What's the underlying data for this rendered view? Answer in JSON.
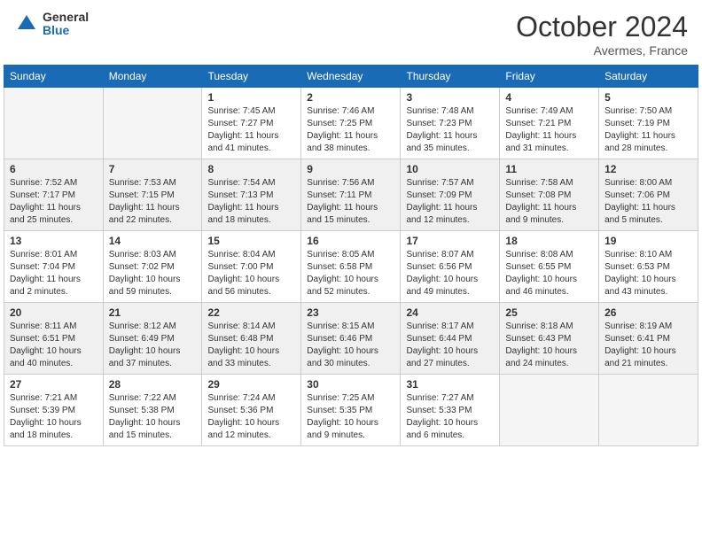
{
  "header": {
    "logo_general": "General",
    "logo_blue": "Blue",
    "month_title": "October 2024",
    "location": "Avermes, France"
  },
  "days_of_week": [
    "Sunday",
    "Monday",
    "Tuesday",
    "Wednesday",
    "Thursday",
    "Friday",
    "Saturday"
  ],
  "weeks": [
    [
      {
        "day": "",
        "empty": true
      },
      {
        "day": "",
        "empty": true
      },
      {
        "day": "1",
        "sunrise": "Sunrise: 7:45 AM",
        "sunset": "Sunset: 7:27 PM",
        "daylight": "Daylight: 11 hours and 41 minutes."
      },
      {
        "day": "2",
        "sunrise": "Sunrise: 7:46 AM",
        "sunset": "Sunset: 7:25 PM",
        "daylight": "Daylight: 11 hours and 38 minutes."
      },
      {
        "day": "3",
        "sunrise": "Sunrise: 7:48 AM",
        "sunset": "Sunset: 7:23 PM",
        "daylight": "Daylight: 11 hours and 35 minutes."
      },
      {
        "day": "4",
        "sunrise": "Sunrise: 7:49 AM",
        "sunset": "Sunset: 7:21 PM",
        "daylight": "Daylight: 11 hours and 31 minutes."
      },
      {
        "day": "5",
        "sunrise": "Sunrise: 7:50 AM",
        "sunset": "Sunset: 7:19 PM",
        "daylight": "Daylight: 11 hours and 28 minutes."
      }
    ],
    [
      {
        "day": "6",
        "sunrise": "Sunrise: 7:52 AM",
        "sunset": "Sunset: 7:17 PM",
        "daylight": "Daylight: 11 hours and 25 minutes."
      },
      {
        "day": "7",
        "sunrise": "Sunrise: 7:53 AM",
        "sunset": "Sunset: 7:15 PM",
        "daylight": "Daylight: 11 hours and 22 minutes."
      },
      {
        "day": "8",
        "sunrise": "Sunrise: 7:54 AM",
        "sunset": "Sunset: 7:13 PM",
        "daylight": "Daylight: 11 hours and 18 minutes."
      },
      {
        "day": "9",
        "sunrise": "Sunrise: 7:56 AM",
        "sunset": "Sunset: 7:11 PM",
        "daylight": "Daylight: 11 hours and 15 minutes."
      },
      {
        "day": "10",
        "sunrise": "Sunrise: 7:57 AM",
        "sunset": "Sunset: 7:09 PM",
        "daylight": "Daylight: 11 hours and 12 minutes."
      },
      {
        "day": "11",
        "sunrise": "Sunrise: 7:58 AM",
        "sunset": "Sunset: 7:08 PM",
        "daylight": "Daylight: 11 hours and 9 minutes."
      },
      {
        "day": "12",
        "sunrise": "Sunrise: 8:00 AM",
        "sunset": "Sunset: 7:06 PM",
        "daylight": "Daylight: 11 hours and 5 minutes."
      }
    ],
    [
      {
        "day": "13",
        "sunrise": "Sunrise: 8:01 AM",
        "sunset": "Sunset: 7:04 PM",
        "daylight": "Daylight: 11 hours and 2 minutes."
      },
      {
        "day": "14",
        "sunrise": "Sunrise: 8:03 AM",
        "sunset": "Sunset: 7:02 PM",
        "daylight": "Daylight: 10 hours and 59 minutes."
      },
      {
        "day": "15",
        "sunrise": "Sunrise: 8:04 AM",
        "sunset": "Sunset: 7:00 PM",
        "daylight": "Daylight: 10 hours and 56 minutes."
      },
      {
        "day": "16",
        "sunrise": "Sunrise: 8:05 AM",
        "sunset": "Sunset: 6:58 PM",
        "daylight": "Daylight: 10 hours and 52 minutes."
      },
      {
        "day": "17",
        "sunrise": "Sunrise: 8:07 AM",
        "sunset": "Sunset: 6:56 PM",
        "daylight": "Daylight: 10 hours and 49 minutes."
      },
      {
        "day": "18",
        "sunrise": "Sunrise: 8:08 AM",
        "sunset": "Sunset: 6:55 PM",
        "daylight": "Daylight: 10 hours and 46 minutes."
      },
      {
        "day": "19",
        "sunrise": "Sunrise: 8:10 AM",
        "sunset": "Sunset: 6:53 PM",
        "daylight": "Daylight: 10 hours and 43 minutes."
      }
    ],
    [
      {
        "day": "20",
        "sunrise": "Sunrise: 8:11 AM",
        "sunset": "Sunset: 6:51 PM",
        "daylight": "Daylight: 10 hours and 40 minutes."
      },
      {
        "day": "21",
        "sunrise": "Sunrise: 8:12 AM",
        "sunset": "Sunset: 6:49 PM",
        "daylight": "Daylight: 10 hours and 37 minutes."
      },
      {
        "day": "22",
        "sunrise": "Sunrise: 8:14 AM",
        "sunset": "Sunset: 6:48 PM",
        "daylight": "Daylight: 10 hours and 33 minutes."
      },
      {
        "day": "23",
        "sunrise": "Sunrise: 8:15 AM",
        "sunset": "Sunset: 6:46 PM",
        "daylight": "Daylight: 10 hours and 30 minutes."
      },
      {
        "day": "24",
        "sunrise": "Sunrise: 8:17 AM",
        "sunset": "Sunset: 6:44 PM",
        "daylight": "Daylight: 10 hours and 27 minutes."
      },
      {
        "day": "25",
        "sunrise": "Sunrise: 8:18 AM",
        "sunset": "Sunset: 6:43 PM",
        "daylight": "Daylight: 10 hours and 24 minutes."
      },
      {
        "day": "26",
        "sunrise": "Sunrise: 8:19 AM",
        "sunset": "Sunset: 6:41 PM",
        "daylight": "Daylight: 10 hours and 21 minutes."
      }
    ],
    [
      {
        "day": "27",
        "sunrise": "Sunrise: 7:21 AM",
        "sunset": "Sunset: 5:39 PM",
        "daylight": "Daylight: 10 hours and 18 minutes."
      },
      {
        "day": "28",
        "sunrise": "Sunrise: 7:22 AM",
        "sunset": "Sunset: 5:38 PM",
        "daylight": "Daylight: 10 hours and 15 minutes."
      },
      {
        "day": "29",
        "sunrise": "Sunrise: 7:24 AM",
        "sunset": "Sunset: 5:36 PM",
        "daylight": "Daylight: 10 hours and 12 minutes."
      },
      {
        "day": "30",
        "sunrise": "Sunrise: 7:25 AM",
        "sunset": "Sunset: 5:35 PM",
        "daylight": "Daylight: 10 hours and 9 minutes."
      },
      {
        "day": "31",
        "sunrise": "Sunrise: 7:27 AM",
        "sunset": "Sunset: 5:33 PM",
        "daylight": "Daylight: 10 hours and 6 minutes."
      },
      {
        "day": "",
        "empty": true
      },
      {
        "day": "",
        "empty": true
      }
    ]
  ]
}
